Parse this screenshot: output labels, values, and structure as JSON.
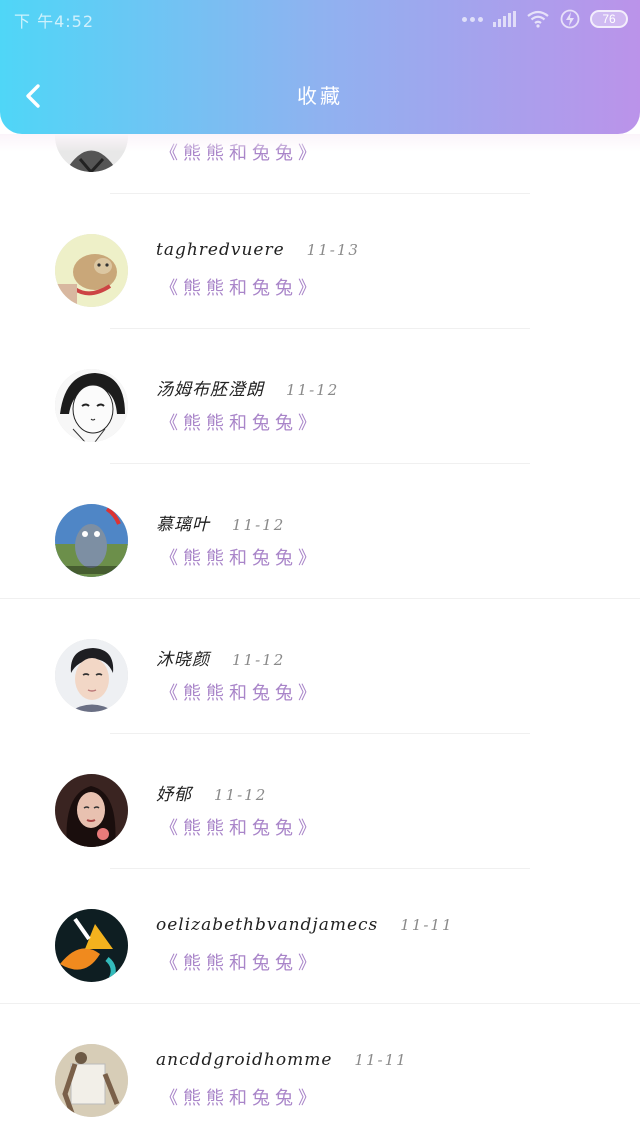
{
  "status": {
    "time": "下 午4:52",
    "battery": "76"
  },
  "header": {
    "title": "收藏"
  },
  "items": [
    {
      "name": "",
      "date": "",
      "story": "《熊熊和兔兔》",
      "avatar_icon": "avatar-icon"
    },
    {
      "name": "taghredvuere",
      "date": "11-13",
      "story": "《熊熊和兔兔》",
      "avatar_icon": "avatar-icon"
    },
    {
      "name": "汤姆布胚澄朗",
      "date": "11-12",
      "story": "《熊熊和兔兔》",
      "avatar_icon": "avatar-icon"
    },
    {
      "name": "慕璃叶",
      "date": "11-12",
      "story": "《熊熊和兔兔》",
      "avatar_icon": "avatar-icon"
    },
    {
      "name": "沐晓颜",
      "date": "11-12",
      "story": "《熊熊和兔兔》",
      "avatar_icon": "avatar-icon"
    },
    {
      "name": "妤郁",
      "date": "11-12",
      "story": "《熊熊和兔兔》",
      "avatar_icon": "avatar-icon"
    },
    {
      "name": "oelizabethbvandjamecs",
      "date": "11-11",
      "story": "《熊熊和兔兔》",
      "avatar_icon": "avatar-icon"
    },
    {
      "name": "ancddgroidhomme",
      "date": "11-11",
      "story": "《熊熊和兔兔》",
      "avatar_icon": "avatar-icon"
    }
  ],
  "colors": {
    "header_start": "#4fd6f7",
    "header_end": "#bb93ea",
    "story": "#a985c9"
  }
}
